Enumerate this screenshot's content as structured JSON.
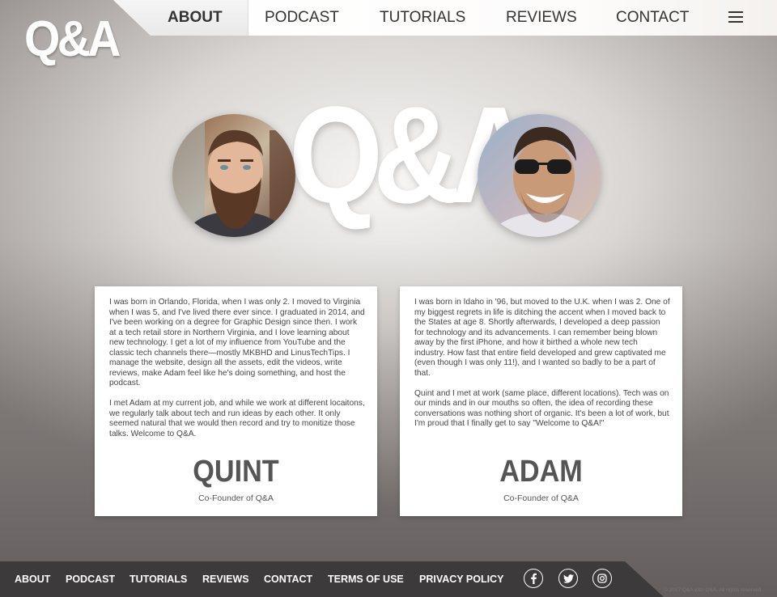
{
  "logo": {
    "text": "Q&A"
  },
  "nav": {
    "items": [
      {
        "label": "ABOUT",
        "active": true
      },
      {
        "label": "PODCAST"
      },
      {
        "label": "TUTORIALS"
      },
      {
        "label": "REVIEWS"
      },
      {
        "label": "CONTACT"
      }
    ],
    "menu_icon": "hamburger-menu-icon"
  },
  "hero": {
    "logo_text": "Q&A"
  },
  "cards": [
    {
      "bio": [
        "I was born in Orlando, Florida, when I was only 2. I moved to Virginia when I was 5, and I've lived there ever since. I graduated in 2014, and I've been working on a degree for Graphic Design since then. I work at a tech retail store in Northern Virginia, and I love learning about new technology. I get a lot of my influence from YouTube and the classic tech channels there—mostly MKBHD and LinusTechTips. I manage the website, design all the assets, edit the videos, write reviews, make Adam feel like he's doing something, and host the podcast.",
        "I met Adam at my current job, and while we work at different locaitons, we regularly talk about tech and run ideas by each other. It only seemed natural that we would then record and try to monitize those talks. Welcome to Q&A."
      ],
      "name": "QUINT",
      "role": "Co-Founder of Q&A"
    },
    {
      "bio": [
        "I was born in Idaho in '96, but moved to the U.K. when I was 2. One of my biggest regrets in life is ditching the accent when I moved back to the States at age 8.  Shortly afterwards, I developed a deep passion for technology and its advancements.  I can remember being blown away by the first iPhone, and how it birthed a whole new tech industry. How fast that entire field developed and grew captivated me (even though I was only 11!), and I wanted so badly to be a part of that.",
        "Quint and I met at work (same place, different locations). Tech was on our minds and in our mouths so often, the idea of recording these conversations was nothing short of organic.  It's been a lot of work, but I'm proud that I finally get to say \"Welcome to Q&A!\""
      ],
      "name": "ADAM",
      "role": "Co-Founder of Q&A"
    }
  ],
  "footer": {
    "links": [
      "ABOUT",
      "PODCAST",
      "TUTORIALS",
      "REVIEWS",
      "CONTACT",
      "TERMS OF USE",
      "PRIVACY POLICY"
    ],
    "social": [
      "facebook-icon",
      "twitter-icon",
      "instagram-icon"
    ],
    "copyright": "© 2017 Q&A with Q&A. All rights reserved."
  },
  "colors": {
    "footer_bg": "#3c3a3a",
    "text_dark": "#333333",
    "card_bg": "#ffffff"
  }
}
